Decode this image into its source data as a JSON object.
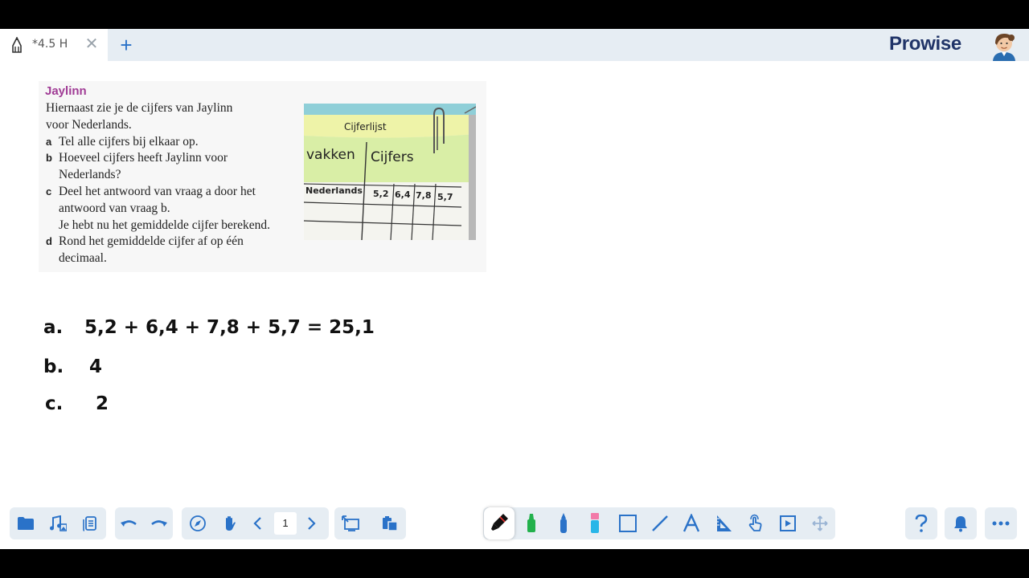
{
  "tab": {
    "title": "*4.5 H",
    "close_symbol": "✕",
    "add_symbol": "+"
  },
  "brand": {
    "logo_text": "Prowise"
  },
  "exercise": {
    "title": "Jaylinn",
    "intro_lines": [
      "Hiernaast zie je de cijfers van Jaylinn",
      "voor Nederlands."
    ],
    "questions": [
      {
        "label": "a",
        "lines": [
          "Tel alle cijfers bij elkaar op."
        ]
      },
      {
        "label": "b",
        "lines": [
          "Hoeveel cijfers heeft Jaylinn voor",
          "Nederlands?"
        ]
      },
      {
        "label": "c",
        "lines": [
          "Deel het antwoord van vraag a door het",
          "antwoord van vraag b.",
          "Je hebt nu het gemiddelde cijfer berekend."
        ]
      },
      {
        "label": "d",
        "lines": [
          "Rond het gemiddelde cijfer af op één",
          "decimaal."
        ]
      }
    ],
    "image": {
      "heading": "Cijferlijst",
      "col_subject": "vakken",
      "col_grades": "Cijfers",
      "row_subject": "Nederlands",
      "grades": [
        "5,2",
        "6,4",
        "7,8",
        "5,7"
      ]
    }
  },
  "handwriting": {
    "a_label": "a.",
    "a_text": "5,2 + 6,4 + 7,8 + 5,7 = 25,1",
    "b_label": "b.",
    "b_text": "4",
    "c_label": "c.",
    "c_text": "2"
  },
  "toolbar": {
    "page_number": "1"
  },
  "colors": {
    "tabbar_bg": "#e6edf3",
    "accent_blue": "#2a72c8",
    "title_purple": "#a03b95",
    "logo_navy": "#203468"
  }
}
